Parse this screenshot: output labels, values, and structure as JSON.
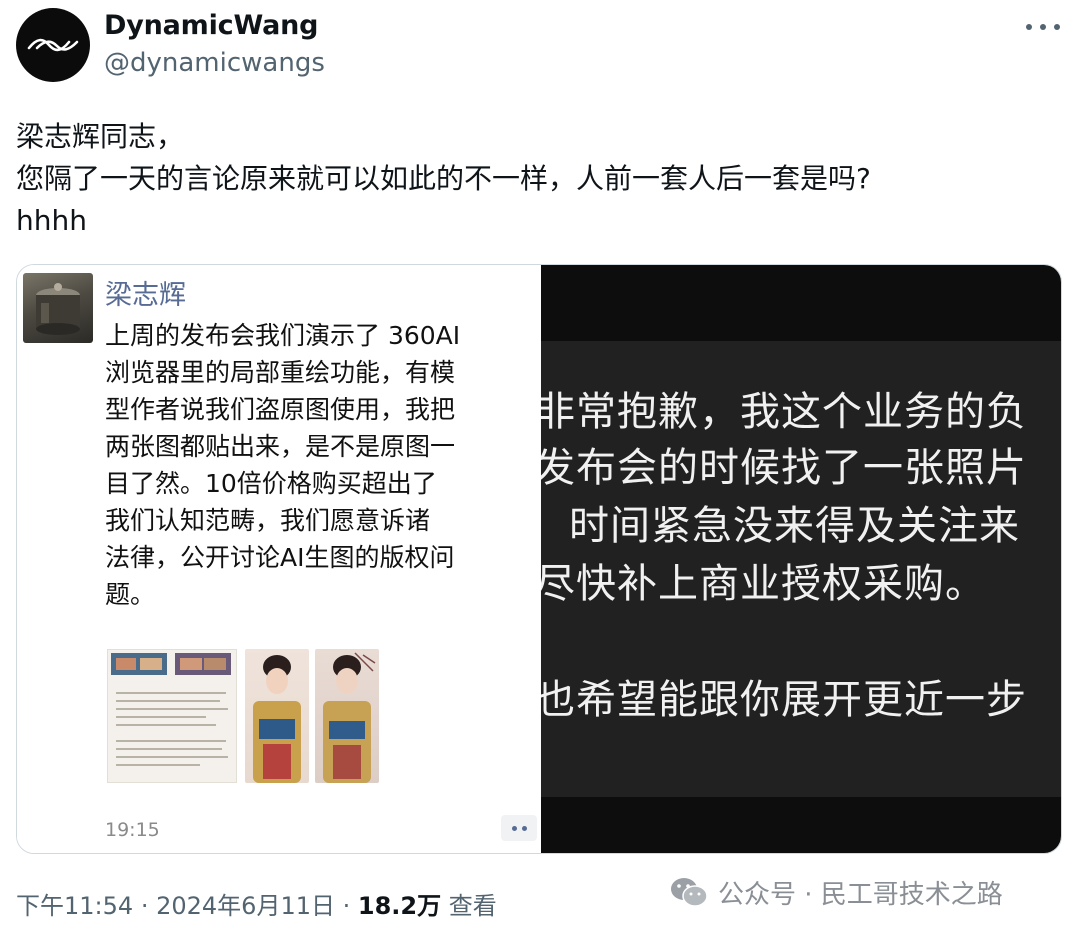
{
  "author": {
    "display_name": "DynamicWang",
    "handle": "@dynamicwangs"
  },
  "tweet": {
    "lines": [
      "梁志辉同志，",
      "您隔了一天的言论原来就可以如此的不一样，人前一套人后一套是吗?",
      "hhhh"
    ]
  },
  "media": {
    "moments_post": {
      "name": "梁志辉",
      "text_lines": [
        "上周的发布会我们演示了 360AI",
        "浏览器里的局部重绘功能，有模",
        "型作者说我们盗原图使用，我把",
        "两张图都贴出来，是不是原图一",
        "目了然。10倍价格购买超出了",
        "我们认知范畴，我们愿意诉诸",
        "法律，公开讨论AI生图的版权问",
        "题。"
      ],
      "time": "19:15"
    },
    "apology_lines": [
      "非常抱歉，我这个业务的负",
      "发布会的时候找了一张照片",
      "时间紧急没来得及关注来",
      "尽快补上商业授权采购。",
      "也希望能跟你展开更近一步"
    ]
  },
  "meta": {
    "time": "下午11:54",
    "date": "2024年6月11日",
    "separator": "·",
    "views_count": "18.2万",
    "views_label": "查看"
  },
  "watermark": {
    "text": "公众号 · 民工哥技术之路"
  },
  "colors": {
    "link_blue": "#576b95",
    "secondary_text": "#536471",
    "dark_panel": "#212121"
  }
}
